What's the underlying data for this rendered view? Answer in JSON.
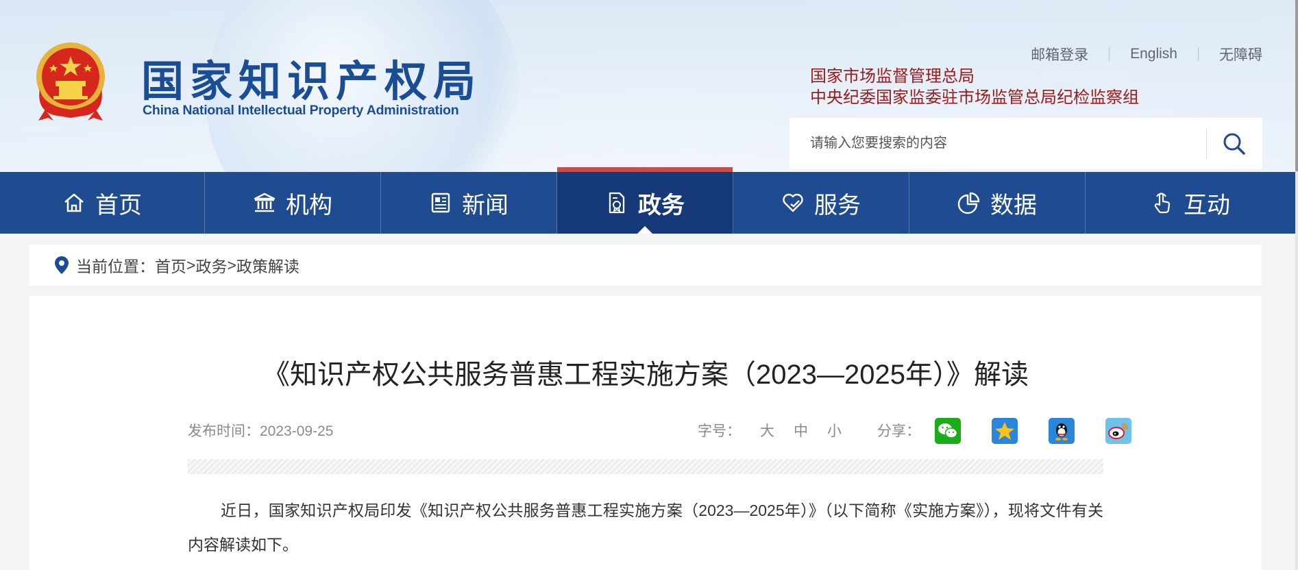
{
  "header": {
    "logo_cn": "国家知识产权局",
    "logo_en": "China National Intellectual Property Administration",
    "top_links": [
      "邮箱登录",
      "English",
      "无障碍"
    ],
    "org_links": [
      "国家市场监督管理总局",
      "中央纪委国家监委驻市场监管总局纪检监察组"
    ],
    "search_placeholder": "请输入您要搜索的内容"
  },
  "nav": {
    "items": [
      {
        "label": "首页",
        "icon": "home-icon"
      },
      {
        "label": "机构",
        "icon": "institution-icon"
      },
      {
        "label": "新闻",
        "icon": "news-icon"
      },
      {
        "label": "政务",
        "icon": "government-affairs-icon"
      },
      {
        "label": "服务",
        "icon": "service-icon"
      },
      {
        "label": "数据",
        "icon": "data-icon"
      },
      {
        "label": "互动",
        "icon": "interaction-icon"
      }
    ],
    "active": "政务"
  },
  "breadcrumb": {
    "prefix": "当前位置：",
    "items": [
      "首页",
      "政务",
      "政策解读"
    ],
    "separator": ">"
  },
  "article": {
    "title": "《知识产权公共服务普惠工程实施方案（2023—2025年）》解读",
    "publish_label": "发布时间：",
    "publish_date": "2023-09-25",
    "font_size_label": "字号：",
    "font_sizes": [
      "大",
      "中",
      "小"
    ],
    "share_label": "分享：",
    "share_targets": [
      "wechat-icon",
      "qzone-icon",
      "qq-icon",
      "weibo-icon"
    ],
    "paragraph": "近日，国家知识产权局印发《知识产权公共服务普惠工程实施方案（2023—2025年）》（以下简称《实施方案》），现将文件有关内容解读如下。"
  },
  "colors": {
    "brand_blue": "#1f4b91",
    "nav_active": "#163a79",
    "nav_active_top": "#c0504d",
    "org_red": "#9c1a1a"
  }
}
